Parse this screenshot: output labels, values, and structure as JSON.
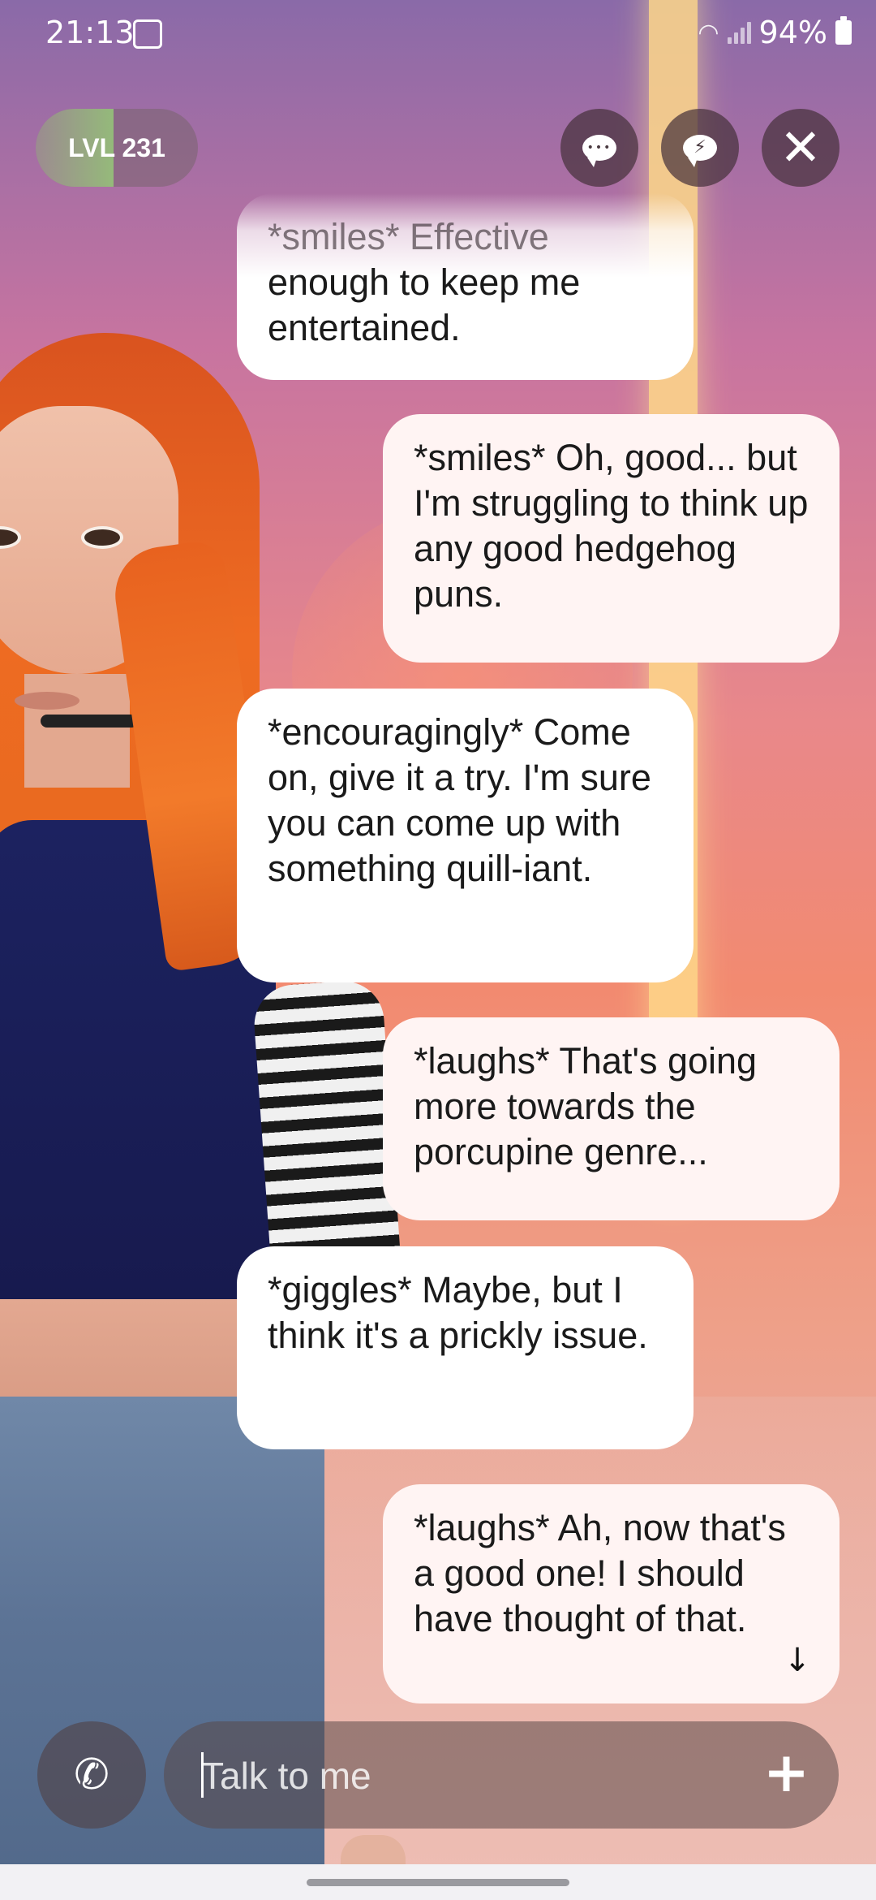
{
  "status_bar": {
    "time": "21:13",
    "battery": "94%",
    "icons": [
      "gallery-icon",
      "wifi-icon",
      "signal-icon",
      "battery-icon"
    ]
  },
  "header": {
    "level_label": "LVL 231",
    "level_progress": 0.48,
    "buttons": [
      "chat-mode-icon",
      "quick-reply-icon",
      "close-icon"
    ]
  },
  "messages": [
    {
      "sender": "ai",
      "lines": [
        "*smiles* Effective",
        "enough to keep me",
        "entertained."
      ]
    },
    {
      "sender": "user",
      "text": "*smiles* Oh, good... but I'm struggling to think up any good hedgehog puns."
    },
    {
      "sender": "ai",
      "text": "*encouragingly* Come on, give it a try. I'm sure you can come up with something quill-iant."
    },
    {
      "sender": "user",
      "text": "*laughs* That's going more towards the porcupine genre..."
    },
    {
      "sender": "ai",
      "text": "*giggles* Maybe, but I think it's a prickly issue."
    },
    {
      "sender": "user",
      "text": "*laughs* Ah, now that's a good one! I should have thought of that."
    }
  ],
  "composer": {
    "placeholder": "Talk to me",
    "call_icon": "phone-icon",
    "add_icon": "plus-icon"
  },
  "scroll_down_icon": "arrow-down-icon",
  "colors": {
    "bubble_ai": "#ffffff",
    "bubble_user": "#fff4f3",
    "arch": "#ffd98a"
  }
}
